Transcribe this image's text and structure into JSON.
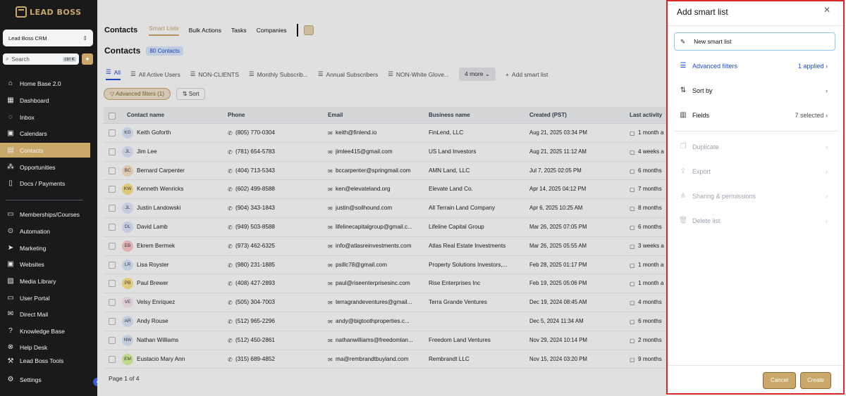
{
  "sidebar": {
    "logo_text": "LEAD BOSS",
    "account": "Lead Boss CRM",
    "search_placeholder": "Search",
    "search_kbd": "ctrl K",
    "items": [
      {
        "label": "Home Base 2.0",
        "icon": "home-icon"
      },
      {
        "label": "Dashboard",
        "icon": "dashboard-icon"
      },
      {
        "label": "Inbox",
        "icon": "chat-icon"
      },
      {
        "label": "Calendars",
        "icon": "calendar-icon"
      },
      {
        "label": "Contacts",
        "icon": "contacts-icon",
        "active": true
      },
      {
        "label": "Opportunities",
        "icon": "opportunities-icon"
      },
      {
        "label": "Docs / Payments",
        "icon": "docs-icon"
      },
      {
        "label": "Memberships/Courses",
        "icon": "monitor-icon"
      },
      {
        "label": "Automation",
        "icon": "automation-icon"
      },
      {
        "label": "Marketing",
        "icon": "send-icon"
      },
      {
        "label": "Websites",
        "icon": "websites-icon"
      },
      {
        "label": "Media Library",
        "icon": "media-icon"
      },
      {
        "label": "User Portal",
        "icon": "portal-icon"
      },
      {
        "label": "Direct Mail",
        "icon": "mail-icon"
      },
      {
        "label": "Knowledge Base",
        "icon": "help-icon"
      },
      {
        "label": "Help Desk",
        "icon": "lifebuoy-icon"
      },
      {
        "label": "Lead Boss Tools",
        "icon": "tools-icon"
      }
    ],
    "settings": "Settings"
  },
  "topnav": {
    "title": "Contacts",
    "tabs": [
      "Smart Lists",
      "Bulk Actions",
      "Tasks",
      "Companies"
    ]
  },
  "heading": {
    "title": "Contacts",
    "count": "80 Contacts"
  },
  "list_tabs": [
    "All",
    "All Active Users",
    "NON-CLIENTS",
    "Monthly Subscrib...",
    "Annual Subscribers",
    "NON-White Glove..."
  ],
  "more_label": "4 more",
  "add_smart_list": "Add smart list",
  "filters": {
    "advanced": "Advanced filters (1)",
    "sort": "Sort"
  },
  "table": {
    "columns": [
      "Contact name",
      "Phone",
      "Email",
      "Business name",
      "Created (PST)",
      "Last activity"
    ],
    "rows": [
      {
        "initials": "KG",
        "name": "Keith Goforth",
        "phone": "(805) 770-0304",
        "email": "keith@finlend.io",
        "business": "FinLend, LLC",
        "created": "Aug 21, 2025 03:34 PM",
        "activity": "1 month a"
      },
      {
        "initials": "JL",
        "name": "Jim Lee",
        "phone": "(781) 654-5783",
        "email": "jimlee415@gmail.com",
        "business": "US Land Investors",
        "created": "Aug 21, 2025 11:12 AM",
        "activity": "4 weeks a"
      },
      {
        "initials": "BC",
        "name": "Bernard Carpenter",
        "phone": "(404) 713-5343",
        "email": "bccarpenter@springmail.com",
        "business": "AMN Land, LLC",
        "created": "Jul 7, 2025 02:05 PM",
        "activity": "6 months"
      },
      {
        "initials": "KW",
        "name": "Kenneth Wenricks",
        "phone": "(602) 499-8588",
        "email": "ken@elevateland.org",
        "business": "Elevate Land Co.",
        "created": "Apr 14, 2025 04:12 PM",
        "activity": "7 months"
      },
      {
        "initials": "JL",
        "name": "Justin Landowski",
        "phone": "(904) 343-1843",
        "email": "justin@soilhound.com",
        "business": "All Terrain Land Company",
        "created": "Apr 6, 2025 10:25 AM",
        "activity": "8 months"
      },
      {
        "initials": "DL",
        "name": "David Lamb",
        "phone": "(949) 503-8588",
        "email": "lifelinecapitalgroup@gmail.c...",
        "business": "Lifeline Capital Group",
        "created": "Mar 26, 2025 07:05 PM",
        "activity": "6 months"
      },
      {
        "initials": "EB",
        "name": "Ekrem Bermek",
        "phone": "(973) 462-6325",
        "email": "info@atlasreinvestments.com",
        "business": "Atlas Real Estate Investments",
        "created": "Mar 26, 2025 05:55 AM",
        "activity": "3 weeks a"
      },
      {
        "initials": "LR",
        "name": "Lisa Royster",
        "phone": "(980) 231-1885",
        "email": "psillc78@gmail.com",
        "business": "Property Solutions Investors,...",
        "created": "Feb 28, 2025 01:17 PM",
        "activity": "1 month a"
      },
      {
        "initials": "PB",
        "name": "Paul Brewer",
        "phone": "(408) 427-2893",
        "email": "paul@riseenterprisesinc.com",
        "business": "Rise Enterprises Inc",
        "created": "Feb 19, 2025 05:06 PM",
        "activity": "1 month a"
      },
      {
        "initials": "VE",
        "name": "Velsy Enriquez",
        "phone": "(505) 304-7003",
        "email": "terragrandeventures@gmail...",
        "business": "Terra Grande Ventures",
        "created": "Dec 19, 2024 08:45 AM",
        "activity": "4 months"
      },
      {
        "initials": "AR",
        "name": "Andy Rouse",
        "phone": "(512) 965-2296",
        "email": "andy@bigtoothproperties.c...",
        "business": "",
        "created": "Dec 5, 2024 11:34 AM",
        "activity": "6 months"
      },
      {
        "initials": "NW",
        "name": "Nathan Williams",
        "phone": "(512) 450-2861",
        "email": "nathanwilliams@freedomlan...",
        "business": "Freedom Land Ventures",
        "created": "Nov 29, 2024 10:14 PM",
        "activity": "2 months"
      },
      {
        "initials": "EM",
        "name": "Eustacio Mary Ann",
        "phone": "(315) 689-4852",
        "email": "ma@rembrandtbuyland.com",
        "business": "Rembrandt LLC",
        "created": "Nov 15, 2024 03:20 PM",
        "activity": "9 months"
      }
    ]
  },
  "pager": "Page 1 of 4",
  "panel": {
    "title": "Add smart list",
    "name_value": "New smart list",
    "rows": [
      {
        "label": "Advanced filters",
        "right": "1 applied",
        "icon": "filter-icon"
      },
      {
        "label": "Sort by",
        "right": "",
        "icon": "sort-icon"
      },
      {
        "label": "Fields",
        "right": "7 selected",
        "icon": "columns-icon"
      },
      {
        "label": "Duplicate",
        "right": "",
        "icon": "copy-icon"
      },
      {
        "label": "Export",
        "right": "",
        "icon": "export-icon"
      },
      {
        "label": "Sharing & permissions",
        "right": "",
        "icon": "share-icon"
      },
      {
        "label": "Delete list",
        "right": "",
        "icon": "trash-icon"
      }
    ],
    "cancel": "Cancel",
    "create": "Create"
  },
  "colors": {
    "accent": "#c9a86a",
    "blue": "#1d4ed8",
    "highlight": "#dc2626"
  }
}
